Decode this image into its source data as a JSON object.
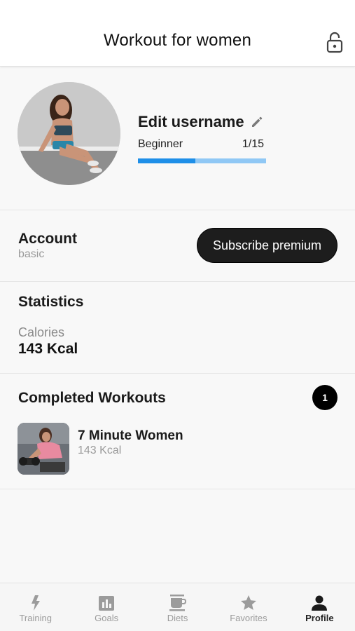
{
  "header": {
    "title": "Workout for women",
    "lock_icon": "unlock-icon"
  },
  "profile": {
    "username": "Edit username",
    "edit_icon": "pencil-icon",
    "level_name": "Beginner",
    "level_progress_text": "1/15",
    "level_progress_fraction": 0.45,
    "progress_fill_color": "#1e8fe8",
    "progress_track_color": "#90c8f5"
  },
  "account": {
    "title": "Account",
    "plan": "basic",
    "subscribe_label": "Subscribe premium"
  },
  "statistics": {
    "title": "Statistics",
    "calories_label": "Calories",
    "calories_value": "143 Kcal"
  },
  "completed": {
    "title": "Completed Workouts",
    "count": "1",
    "items": [
      {
        "name": "7 Minute Women",
        "kcal": "143 Kcal"
      }
    ]
  },
  "tabs": [
    {
      "label": "Training",
      "icon": "lightning-icon",
      "active": false
    },
    {
      "label": "Goals",
      "icon": "bar-chart-icon",
      "active": false
    },
    {
      "label": "Diets",
      "icon": "coffee-cup-icon",
      "active": false
    },
    {
      "label": "Favorites",
      "icon": "star-icon",
      "active": false
    },
    {
      "label": "Profile",
      "icon": "person-icon",
      "active": true
    }
  ]
}
